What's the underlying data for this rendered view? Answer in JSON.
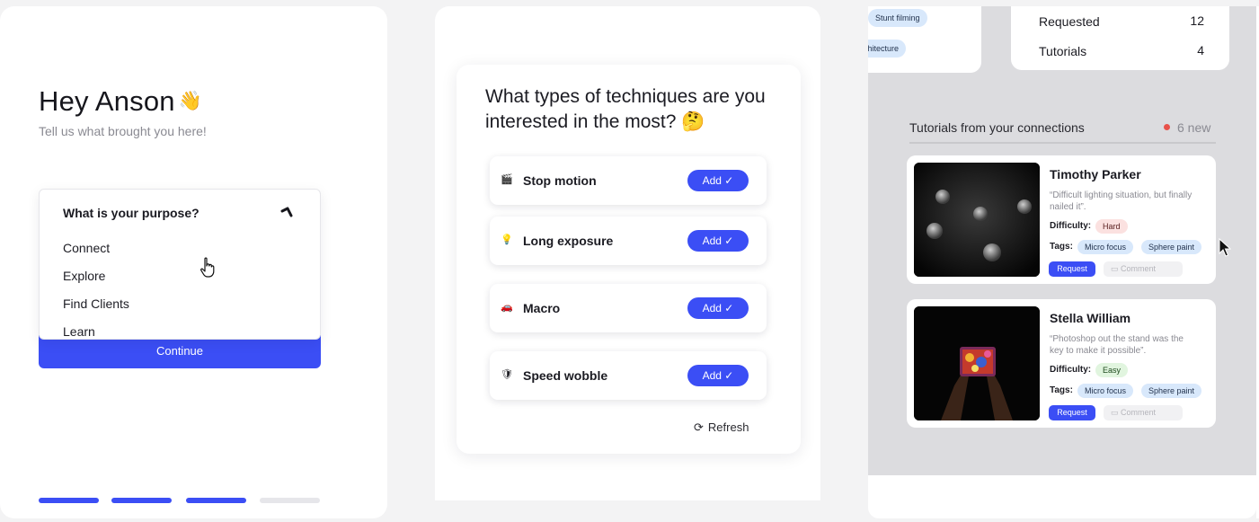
{
  "onboarding": {
    "greeting": "Hey Anson",
    "subtitle": "Tell us what brought you here!",
    "purpose_dropdown": {
      "label": "What is your purpose?",
      "options": [
        "Connect",
        "Explore",
        "Find Clients",
        "Learn"
      ]
    },
    "continue_label": "Continue",
    "progress_steps": [
      true,
      true,
      true,
      false
    ]
  },
  "techniques": {
    "question": "What types of techniques are you interested in the most?",
    "items": [
      {
        "label": "Stop motion",
        "icon": "clapperboard-icon",
        "glyph": "🎬",
        "add_label": "Add ✓"
      },
      {
        "label": "Long exposure",
        "icon": "lightbulb-icon",
        "glyph": "💡",
        "add_label": "Add ✓"
      },
      {
        "label": "Macro",
        "icon": "car-icon",
        "glyph": "🚗",
        "add_label": "Add ✓"
      },
      {
        "label": "Speed wobble",
        "icon": "shield-icon",
        "glyph": "🛡",
        "add_label": "Add ✓"
      }
    ],
    "refresh_label": "Refresh"
  },
  "dashboard": {
    "tag_chips": [
      "Stunt filming",
      "Architecture"
    ],
    "stats": [
      {
        "label": "Requested",
        "value": "12"
      },
      {
        "label": "Tutorials",
        "value": "4"
      }
    ],
    "feed_title": "Tutorials from your connections",
    "new_count": "6 new",
    "tutorials": [
      {
        "name": "Timothy Parker",
        "quote": "“Difficult lighting situation, but finally nailed it”.",
        "difficulty_label": "Difficulty:",
        "difficulty": "Hard",
        "difficulty_color": "#fbe1e0",
        "tags_label": "Tags:",
        "tags": [
          "Micro focus",
          "Sphere paint"
        ],
        "request_label": "Request",
        "comment_label": "Comment"
      },
      {
        "name": "Stella William",
        "quote": "“Photoshop out the stand was the key to make it possible”.",
        "difficulty_label": "Difficulty:",
        "difficulty": "Easy",
        "difficulty_color": "#e1f5df",
        "tags_label": "Tags:",
        "tags": [
          "Micro focus",
          "Sphere paint"
        ],
        "request_label": "Request",
        "comment_label": "Comment"
      }
    ]
  },
  "colors": {
    "accent": "#3b4ef5",
    "tag_chip": "#d8e8fb",
    "new_dot": "#e8514a"
  }
}
